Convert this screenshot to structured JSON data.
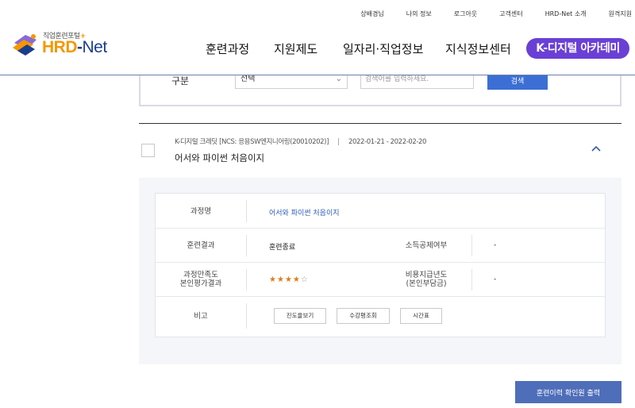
{
  "header": {
    "util_links": [
      "상배경님",
      "나의 정보",
      "로그아웃",
      "고객센터",
      "HRD-Net 소개",
      "원격지원"
    ],
    "logo": {
      "subtitle": "직업훈련포털",
      "plus": "+",
      "main_hrd": "HRD",
      "main_dash": "-",
      "main_net": "Net"
    },
    "nav": [
      "훈련과정",
      "지원제도",
      "일자리·직업정보",
      "지식정보센터"
    ],
    "nav_highlight": "K-디지털 아카데미"
  },
  "search": {
    "label": "구분",
    "select_value": "선택",
    "input_placeholder": "검색어를 입력하세요.",
    "button": "검색"
  },
  "course": {
    "meta_category": "K-디지털 크레딧 [NCS: 응용SW엔지니어링(20010202)]",
    "meta_period": "2022-01-21 - 2022-02-20",
    "title": "어서와 파이썬 처음이지",
    "details": {
      "course_name_label": "과정명",
      "course_name_value": "어서와 파이썬 처음이지",
      "result_label": "훈련결과",
      "result_value": "훈련종료",
      "tax_label": "소득공제여부",
      "tax_value": "-",
      "satisfaction_label_1": "과정만족도",
      "satisfaction_label_2": "본인평가결과",
      "rating": 4,
      "rating_max": 5,
      "cost_label_1": "비용지급년도",
      "cost_label_2": "(본인부담금)",
      "cost_value": "-",
      "remark_label": "비고",
      "buttons": [
        "진도율보기",
        "수강평조회",
        "시간표"
      ]
    }
  },
  "print_button": "훈련이력 확인원 출력",
  "colors": {
    "brand_orange": "#f39800",
    "brand_navy": "#1a3e8e",
    "nav_highlight_bg": "#6a3fd6",
    "search_button_bg": "#3c6fd4",
    "print_button_bg": "#4f6eb9",
    "link": "#2e5cb8",
    "star_on": "#e07a1a"
  }
}
